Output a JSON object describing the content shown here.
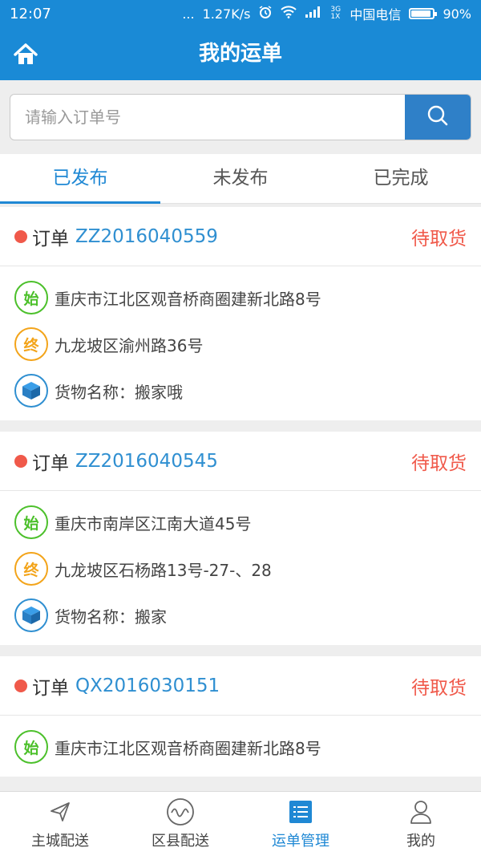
{
  "statusbar": {
    "time": "12:07",
    "dots": "...",
    "speed": "1.27K/s",
    "network": "3G 1X",
    "carrier": "中国电信",
    "battery": "90%"
  },
  "header": {
    "title": "我的运单"
  },
  "search": {
    "placeholder": "请输入订单号"
  },
  "tabs": [
    {
      "label": "已发布"
    },
    {
      "label": "未发布"
    },
    {
      "label": "已完成"
    }
  ],
  "orders": [
    {
      "label": "订单",
      "number": "ZZ2016040559",
      "status": "待取货",
      "start_badge": "始",
      "start": "重庆市江北区观音桥商圈建新北路8号",
      "end_badge": "终",
      "end": "九龙坡区渝州路36号",
      "goods": "货物名称：搬家哦"
    },
    {
      "label": "订单",
      "number": "ZZ2016040545",
      "status": "待取货",
      "start_badge": "始",
      "start": "重庆市南岸区江南大道45号",
      "end_badge": "终",
      "end": "九龙坡区石杨路13号-27-、28",
      "goods": "货物名称：搬家"
    },
    {
      "label": "订单",
      "number": "QX2016030151",
      "status": "待取货",
      "start_badge": "始",
      "start": "重庆市江北区观音桥商圈建新北路8号"
    }
  ],
  "nav": [
    {
      "label": "主城配送"
    },
    {
      "label": "区县配送"
    },
    {
      "label": "运单管理"
    },
    {
      "label": "我的"
    }
  ],
  "colors": {
    "primary": "#1a8ad6",
    "status_red": "#f0594a",
    "start_green": "#4cc02b",
    "end_orange": "#f3a41a"
  }
}
